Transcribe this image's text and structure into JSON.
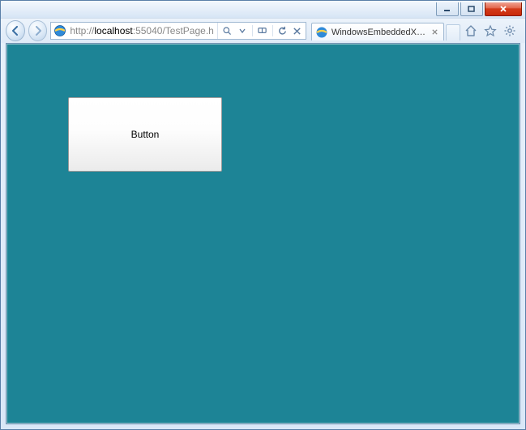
{
  "window": {
    "controls": {
      "minimize": "minimize",
      "maximize": "restore",
      "close": "close"
    }
  },
  "nav": {
    "url_display": "http://localhost:55040/TestPage.h",
    "url_host": "localhost"
  },
  "tab": {
    "title": "WindowsEmbeddedX…"
  },
  "page": {
    "bg_color": "#1d8496",
    "button_label": "Button"
  }
}
